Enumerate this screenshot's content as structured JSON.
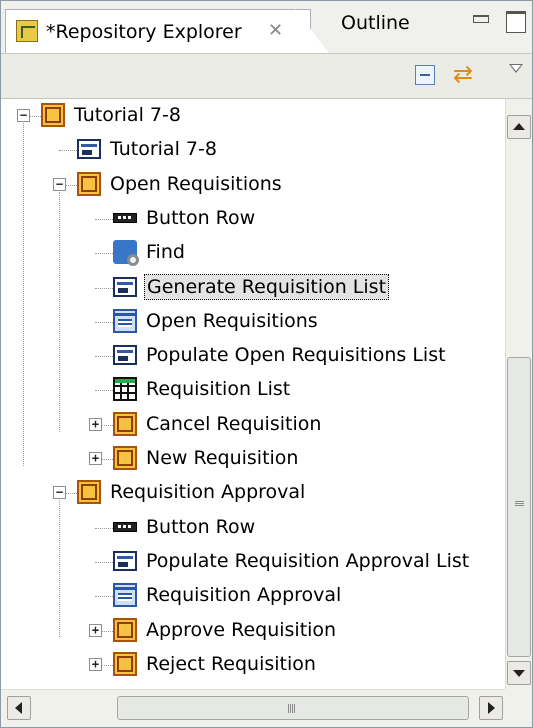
{
  "tabs": {
    "active": {
      "title": "*Repository Explorer",
      "icon": "repository-icon",
      "close_glyph": "✕"
    },
    "inactive": {
      "title": "Outline"
    }
  },
  "toolbar": {
    "icons": [
      "collapse-all-icon",
      "link-with-editor-icon",
      "view-menu-icon"
    ]
  },
  "tree": {
    "root": {
      "label": "Tutorial 7-8",
      "icon": "application-folder-icon",
      "expanded": true
    },
    "items": [
      {
        "label": "Tutorial 7-8",
        "icon": "panel-icon",
        "depth": 1
      },
      {
        "label": "Open Requisitions",
        "icon": "application-folder-icon",
        "depth": 1,
        "expanded": true
      },
      {
        "label": "Button Row",
        "icon": "button-row-icon",
        "depth": 2
      },
      {
        "label": "Find",
        "icon": "find-icon",
        "depth": 2
      },
      {
        "label": "Generate Requisition List",
        "icon": "panel-icon",
        "depth": 2,
        "selected": true
      },
      {
        "label": "Open Requisitions",
        "icon": "form-icon",
        "depth": 2
      },
      {
        "label": "Populate Open Requisitions List",
        "icon": "panel-icon",
        "depth": 2
      },
      {
        "label": "Requisition List",
        "icon": "grid-icon",
        "depth": 2
      },
      {
        "label": "Cancel Requisition",
        "icon": "application-folder-icon",
        "depth": 2,
        "expanded": false
      },
      {
        "label": "New Requisition",
        "icon": "application-folder-icon",
        "depth": 2,
        "expanded": false
      },
      {
        "label": "Requisition Approval",
        "icon": "application-folder-icon",
        "depth": 1,
        "expanded": true
      },
      {
        "label": "Button Row",
        "icon": "button-row-icon",
        "depth": 2
      },
      {
        "label": "Populate Requisition Approval List",
        "icon": "panel-icon",
        "depth": 2
      },
      {
        "label": "Requisition Approval",
        "icon": "form-icon",
        "depth": 2
      },
      {
        "label": "Approve Requisition",
        "icon": "application-folder-icon",
        "depth": 2,
        "expanded": false
      },
      {
        "label": "Reject Requisition",
        "icon": "application-folder-icon",
        "depth": 2,
        "expanded": false
      }
    ]
  },
  "scrollbars": {
    "vertical": true,
    "horizontal": true
  },
  "colors": {
    "selection_bg": "#e3e3e3",
    "folder_fill": "#f5c242",
    "folder_stroke": "#a8530c",
    "panel_blue": "#2f5aa8"
  }
}
